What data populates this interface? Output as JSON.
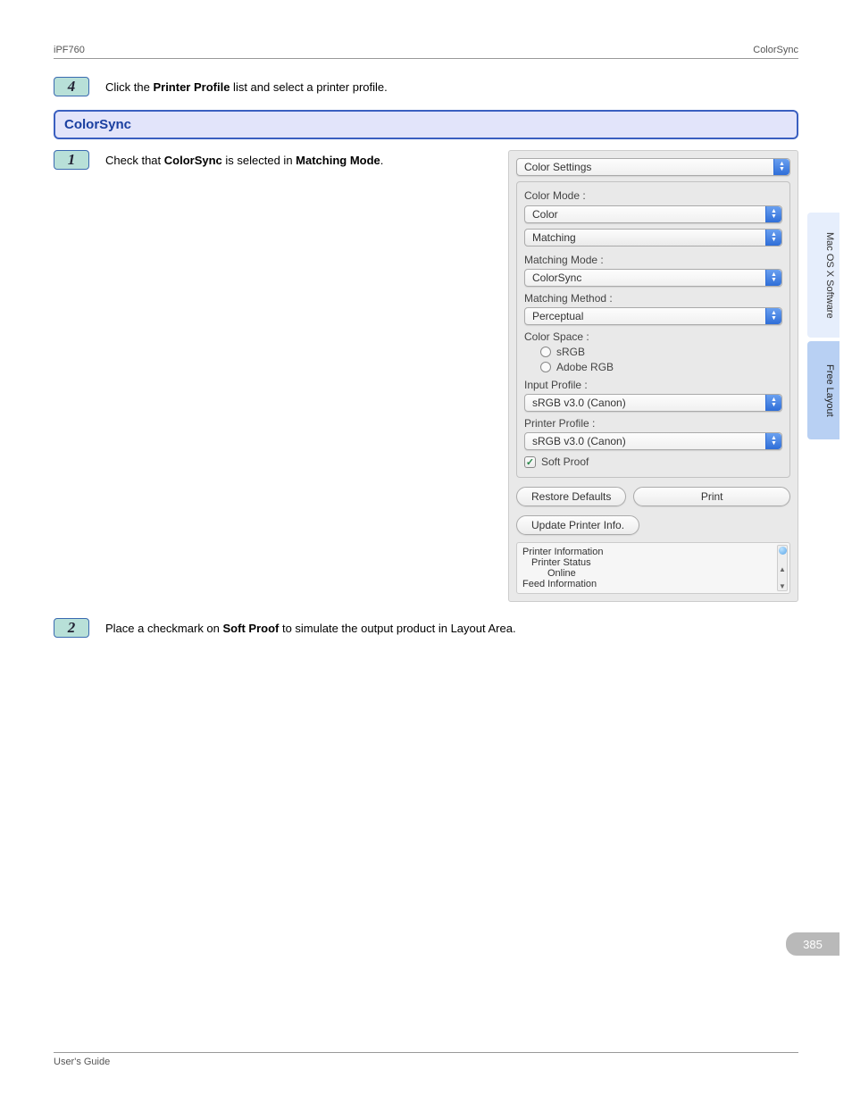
{
  "header": {
    "left": "iPF760",
    "right": "ColorSync"
  },
  "step4": {
    "num": "4",
    "text_pre": "Click the ",
    "text_bold": "Printer Profile",
    "text_post": " list and select a printer profile."
  },
  "section_title": "ColorSync",
  "step1": {
    "num": "1",
    "t1": "Check that ",
    "b1": "ColorSync",
    "t2": " is selected in ",
    "b2": "Matching Mode",
    "t3": "."
  },
  "dialog": {
    "top_select": "Color Settings",
    "color_mode_label": "Color Mode :",
    "color_mode_value": "Color",
    "tab": "Matching",
    "mm_label": "Matching Mode :",
    "mm_value": "ColorSync",
    "mmeth_label": "Matching Method :",
    "mmeth_value": "Perceptual",
    "cs_label": "Color Space :",
    "cs_opt1": "sRGB",
    "cs_opt2": "Adobe RGB",
    "ip_label": "Input Profile :",
    "ip_value": "sRGB v3.0 (Canon)",
    "pp_label": "Printer Profile :",
    "pp_value": "sRGB v3.0 (Canon)",
    "softproof": "Soft Proof",
    "btn_restore": "Restore Defaults",
    "btn_print": "Print",
    "btn_update": "Update Printer Info.",
    "info_l1": "Printer Information",
    "info_l2": "Printer Status",
    "info_l3": "Online",
    "info_l4": "Feed Information"
  },
  "step2": {
    "num": "2",
    "t1": "Place a checkmark on ",
    "b1": "Soft Proof",
    "t2": " to simulate the output product in Layout Area."
  },
  "sidetabs": {
    "t1": "Mac OS X Software",
    "t2": "Free Layout"
  },
  "page_number": "385",
  "footer": "User's Guide"
}
